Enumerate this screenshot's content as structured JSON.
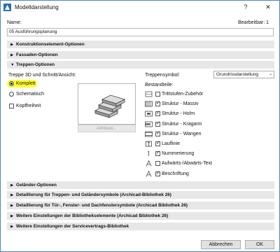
{
  "window": {
    "title": "Modelldarstellung",
    "help_label": "?",
    "close_label": "✕"
  },
  "name_label": "Name:",
  "editable_label": "Bearbeitbar: 1",
  "name_value": "05 Ausführungsplanung",
  "sections": {
    "konstruktion": "Konstruktionselement-Optionen",
    "fassaden": "Fassaden-Optionen",
    "treppen": "Treppen-Optionen",
    "gelaender": "Geländer-Optionen",
    "detail_treppe": "Detaillierung für Treppen- und Geländersymbole (Archicad-Bibliothek 26)",
    "detail_tuer": "Detaillierung für Tür-, Fenster- und Dachfenstersymbole (Archicad Bibliothek 26)",
    "bibliothek": "Weitere Einstellungen der Bibliothekselemente (Archicad Bibliothek 26)",
    "service": "Weitere Einstellungen der Servicevertrags-Bibliothek"
  },
  "arrows": {
    "collapsed": "▶",
    "expanded": "▼"
  },
  "stairs": {
    "view_label": "Treppe 3D und Schnitt/Ansicht:",
    "option_complete": "Komplett",
    "option_schematic": "Schematisch",
    "selected": "Komplett",
    "headroom_label": "Kopffreiheit",
    "headroom_checked": false,
    "attribute_button": "Attribute...",
    "symbol_label": "Treppensymbol:",
    "symbol_value": "Grundrissdarstellung",
    "components_label": "Bestandteile:",
    "components": [
      {
        "label": "Trittstufen-Zubehör",
        "checked": false,
        "icon": "tread-accessory-icon"
      },
      {
        "label": "Struktur - Massiv",
        "checked": true,
        "icon": "solid-structure-icon"
      },
      {
        "label": "Struktur - Holm",
        "checked": true,
        "icon": "beam-structure-icon"
      },
      {
        "label": "Struktur - Kragarm",
        "checked": true,
        "icon": "cantilever-structure-icon"
      },
      {
        "label": "Struktur - Wangen",
        "checked": true,
        "icon": "stringer-structure-icon"
      },
      {
        "label": "Lauflinie",
        "checked": true,
        "icon": "walking-line-icon"
      },
      {
        "label": "Nummerierung",
        "checked": true,
        "icon": "numbering-icon"
      },
      {
        "label": "Aufwärts-/Abwärts-Text",
        "checked": false,
        "icon": "up-down-text-icon"
      },
      {
        "label": "Beschriftung",
        "checked": true,
        "icon": "label-text-icon"
      }
    ]
  },
  "buttons": {
    "cancel": "Abbrechen",
    "ok": "OK"
  },
  "colors": {
    "border": "#4a86c8",
    "section_bg": "#e7e7e7",
    "highlight": "#ffff33"
  }
}
